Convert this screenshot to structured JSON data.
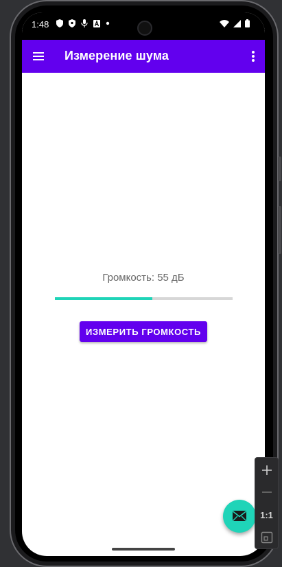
{
  "status_bar": {
    "time": "1:48"
  },
  "app_bar": {
    "title": "Измерение шума",
    "background_color": "#6200ee",
    "menu_icon": "hamburger-menu-icon",
    "overflow_icon": "more-vert-icon"
  },
  "main": {
    "volume_text": "Громкость: 55 дБ",
    "progress_fraction": 0.55,
    "progress_color": "#1fd4b8",
    "measure_button_label": "ИЗМЕРИТЬ ГРОМКОСТЬ"
  },
  "fab": {
    "icon": "mail-icon",
    "color": "#1fd4b8"
  },
  "zoom_controls": {
    "zoom_in_icon": "plus-icon",
    "zoom_out_icon": "minus-icon",
    "actual_size_label": "1:1",
    "fit_icon": "fit-screen-icon"
  }
}
